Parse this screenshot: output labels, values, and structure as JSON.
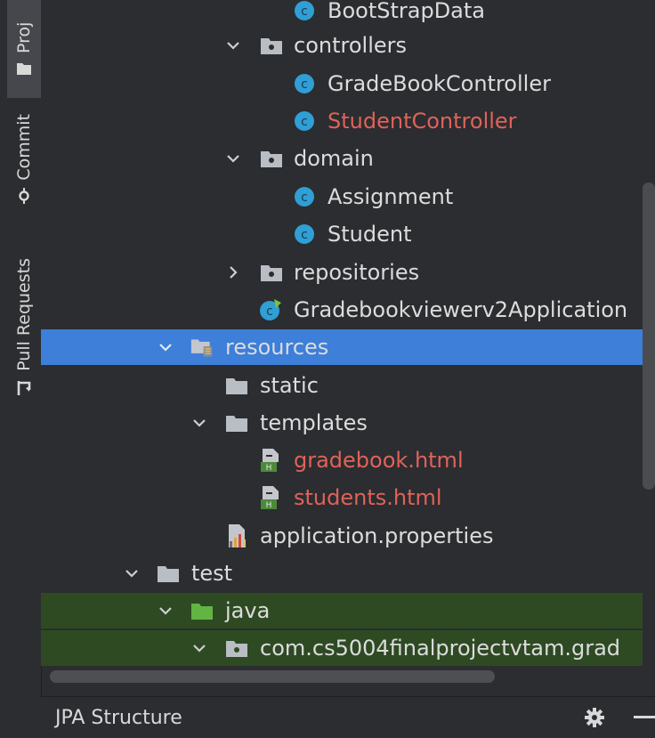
{
  "sidebar": {
    "tabs": [
      {
        "label": "Proj",
        "icon": "folder-icon",
        "active": true
      },
      {
        "label": "Commit",
        "icon": "commit-icon",
        "active": false
      },
      {
        "label": "Pull Requests",
        "icon": "pull-request-icon",
        "active": false
      }
    ]
  },
  "tree": {
    "rows": [
      {
        "label": "BootStrapData",
        "icon": "class-icon"
      },
      {
        "label": "controllers",
        "icon": "package-folder-icon",
        "expanded": true
      },
      {
        "label": "GradeBookController",
        "icon": "class-icon"
      },
      {
        "label": "StudentController",
        "icon": "class-icon",
        "status": "modified-red"
      },
      {
        "label": "domain",
        "icon": "package-folder-icon",
        "expanded": true
      },
      {
        "label": "Assignment",
        "icon": "class-icon"
      },
      {
        "label": "Student",
        "icon": "class-icon"
      },
      {
        "label": "repositories",
        "icon": "package-folder-icon",
        "expanded": false
      },
      {
        "label": "Gradebookviewerv2Application",
        "icon": "spring-boot-class-icon"
      },
      {
        "label": "resources",
        "icon": "resources-folder-icon",
        "expanded": true,
        "selected": true
      },
      {
        "label": "static",
        "icon": "folder-icon"
      },
      {
        "label": "templates",
        "icon": "folder-icon",
        "expanded": true
      },
      {
        "label": "gradebook.html",
        "icon": "html-file-icon",
        "status": "modified-red"
      },
      {
        "label": "students.html",
        "icon": "html-file-icon",
        "status": "modified-red"
      },
      {
        "label": "application.properties",
        "icon": "properties-file-icon"
      },
      {
        "label": "test",
        "icon": "folder-icon",
        "expanded": true
      },
      {
        "label": "java",
        "icon": "test-source-folder-icon",
        "expanded": true
      },
      {
        "label": "com.cs5004finalprojectvtam.grad",
        "icon": "package-folder-icon",
        "expanded": true
      }
    ]
  },
  "bottom_panel": {
    "title": "JPA Structure"
  },
  "colors": {
    "selection": "#3d7fd9",
    "test_highlight": "#2e4a23",
    "modified": "#e0625a",
    "class_icon": "#2f9fd6"
  }
}
